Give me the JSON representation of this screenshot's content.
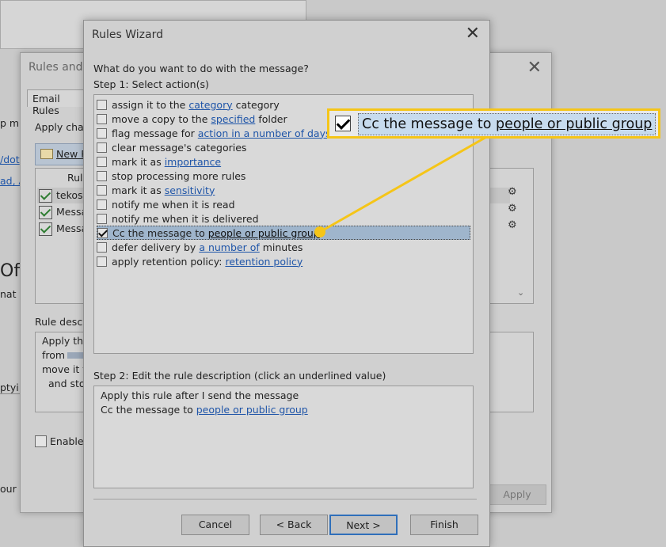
{
  "rules_dialog": {
    "title": "Rules and A",
    "tab": "Email Rules",
    "apply_label": "Apply char",
    "new_rule": "New R",
    "rule_header": "Rule (",
    "rules": [
      "tekosh",
      "Messa",
      "Messa"
    ],
    "desc_label": "Rule descr",
    "desc_lines": [
      "Apply thi",
      "from",
      "move it t",
      "and sto"
    ],
    "enable_label": "Enable",
    "apply_button": "Apply"
  },
  "left_fragments": {
    "l1": "p m",
    "l2": "/dot",
    "l3": "ad, A",
    "l4": "Off",
    "l5": "nat y",
    "l6": "ptyi",
    "l7": "our i"
  },
  "wizard": {
    "title": "Rules Wizard",
    "question": "What do you want to do with the message?",
    "step1": "Step 1: Select action(s)",
    "actions": [
      {
        "pre": "assign it to the ",
        "link": "category",
        "post": " category",
        "checked": false
      },
      {
        "pre": "move a copy to the ",
        "link": "specified",
        "post": " folder",
        "checked": false
      },
      {
        "pre": "flag message for ",
        "link": "action in a number of days",
        "post": "",
        "checked": false
      },
      {
        "pre": "clear message's categories",
        "link": "",
        "post": "",
        "checked": false
      },
      {
        "pre": "mark it as ",
        "link": "importance",
        "post": "",
        "checked": false
      },
      {
        "pre": "stop processing more rules",
        "link": "",
        "post": "",
        "checked": false
      },
      {
        "pre": "mark it as ",
        "link": "sensitivity",
        "post": "",
        "checked": false
      },
      {
        "pre": "notify me when it is read",
        "link": "",
        "post": "",
        "checked": false
      },
      {
        "pre": "notify me when it is delivered",
        "link": "",
        "post": "",
        "checked": false
      },
      {
        "pre": "Cc the message to ",
        "link": "people or public group",
        "post": "",
        "checked": true
      },
      {
        "pre": "defer delivery by ",
        "link": "a number of",
        "post": " minutes",
        "checked": false
      },
      {
        "pre": "apply retention policy: ",
        "link": "retention policy",
        "post": "",
        "checked": false
      }
    ],
    "step2": "Step 2: Edit the rule description (click an underlined value)",
    "desc_line1": "Apply this rule after I send the message",
    "desc_line2_pre": "Cc the message to ",
    "desc_line2_link": "people or public group",
    "buttons": {
      "cancel": "Cancel",
      "back": "< Back",
      "next": "Next >",
      "finish": "Finish"
    }
  },
  "callout": {
    "pre": "Cc the message to ",
    "link": "people or public group",
    "color": "#f5c518"
  }
}
